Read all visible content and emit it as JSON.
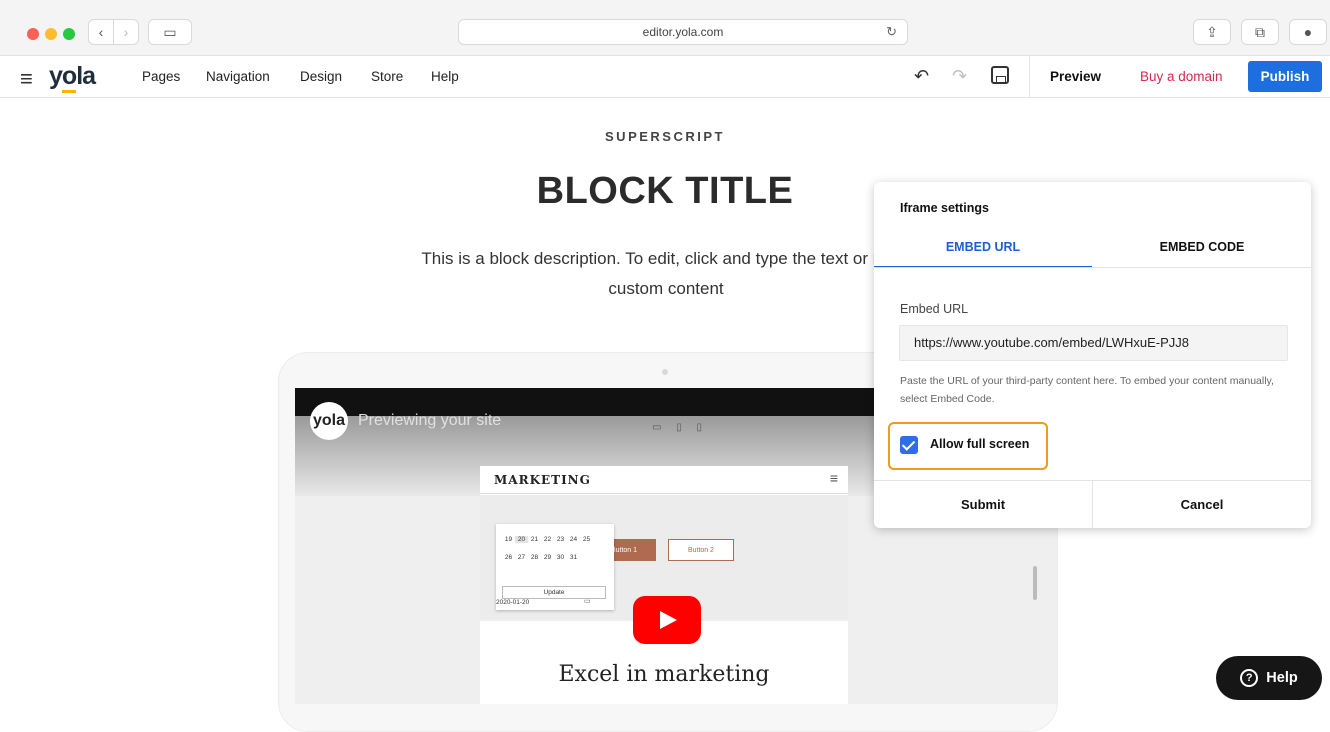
{
  "browser": {
    "url": "editor.yola.com",
    "back_icon": "‹",
    "forward_icon": "›",
    "sidebar_icon": "▭",
    "reload_icon": "↻",
    "share_icon": "⇪",
    "tabs_icon": "⧉",
    "extension_icon": "●"
  },
  "editor": {
    "hamburger": "≡",
    "logo_pre": "y",
    "logo_o": "o",
    "logo_post": "la",
    "menu": [
      {
        "label": "Pages"
      },
      {
        "label": "Navigation"
      },
      {
        "label": "Design"
      },
      {
        "label": "Store"
      },
      {
        "label": "Help"
      }
    ],
    "undo_icon": "↶",
    "redo_icon": "↷",
    "preview": "Preview",
    "buy_domain": "Buy a domain",
    "publish": "Publish",
    "colors": {
      "accent": "#1d6fe0",
      "domain": "#d7264e"
    }
  },
  "block": {
    "superscript": "SUPERSCRIPT",
    "title": "BLOCK TITLE",
    "description_line1": "This is a block description. To edit, click and type the text or repla",
    "description_line2": "custom content"
  },
  "video": {
    "logo": "yola",
    "preview_text": "Previewing your site",
    "device_icons": "▭ ▯ ▯",
    "site_brand": "MARKETING",
    "site_menu": "≡",
    "button1": "Button 1",
    "button2": "Button 2",
    "calendar_row1": [
      "19",
      "20",
      "21",
      "22",
      "23",
      "24",
      "25"
    ],
    "calendar_row2": [
      "26",
      "27",
      "28",
      "29",
      "30",
      "31"
    ],
    "calendar_update": "Update",
    "date_value": "2020-01-20",
    "heading": "Excel in marketing"
  },
  "iframe_panel": {
    "title": "Iframe settings",
    "tabs": [
      {
        "label": "EMBED URL",
        "active": true
      },
      {
        "label": "EMBED CODE",
        "active": false
      }
    ],
    "field_label": "Embed URL",
    "url_value": "https://www.youtube.com/embed/LWHxuE-PJJ8",
    "help_text": "Paste the URL of your third-party content here. To embed your content manually, select Embed Code.",
    "allow_full_screen_label": "Allow full screen",
    "allow_full_screen_checked": true,
    "submit": "Submit",
    "cancel": "Cancel",
    "highlight_color": "#f29a1b"
  },
  "help_button": {
    "icon": "?",
    "label": "Help"
  }
}
